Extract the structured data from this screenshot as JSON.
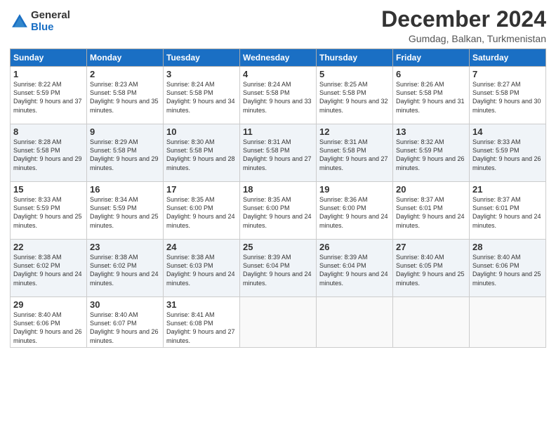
{
  "logo": {
    "general": "General",
    "blue": "Blue"
  },
  "header": {
    "month_title": "December 2024",
    "location": "Gumdag, Balkan, Turkmenistan"
  },
  "days_of_week": [
    "Sunday",
    "Monday",
    "Tuesday",
    "Wednesday",
    "Thursday",
    "Friday",
    "Saturday"
  ],
  "weeks": [
    [
      {
        "day": "1",
        "sunrise": "Sunrise: 8:22 AM",
        "sunset": "Sunset: 5:59 PM",
        "daylight": "Daylight: 9 hours and 37 minutes."
      },
      {
        "day": "2",
        "sunrise": "Sunrise: 8:23 AM",
        "sunset": "Sunset: 5:58 PM",
        "daylight": "Daylight: 9 hours and 35 minutes."
      },
      {
        "day": "3",
        "sunrise": "Sunrise: 8:24 AM",
        "sunset": "Sunset: 5:58 PM",
        "daylight": "Daylight: 9 hours and 34 minutes."
      },
      {
        "day": "4",
        "sunrise": "Sunrise: 8:24 AM",
        "sunset": "Sunset: 5:58 PM",
        "daylight": "Daylight: 9 hours and 33 minutes."
      },
      {
        "day": "5",
        "sunrise": "Sunrise: 8:25 AM",
        "sunset": "Sunset: 5:58 PM",
        "daylight": "Daylight: 9 hours and 32 minutes."
      },
      {
        "day": "6",
        "sunrise": "Sunrise: 8:26 AM",
        "sunset": "Sunset: 5:58 PM",
        "daylight": "Daylight: 9 hours and 31 minutes."
      },
      {
        "day": "7",
        "sunrise": "Sunrise: 8:27 AM",
        "sunset": "Sunset: 5:58 PM",
        "daylight": "Daylight: 9 hours and 30 minutes."
      }
    ],
    [
      {
        "day": "8",
        "sunrise": "Sunrise: 8:28 AM",
        "sunset": "Sunset: 5:58 PM",
        "daylight": "Daylight: 9 hours and 29 minutes."
      },
      {
        "day": "9",
        "sunrise": "Sunrise: 8:29 AM",
        "sunset": "Sunset: 5:58 PM",
        "daylight": "Daylight: 9 hours and 29 minutes."
      },
      {
        "day": "10",
        "sunrise": "Sunrise: 8:30 AM",
        "sunset": "Sunset: 5:58 PM",
        "daylight": "Daylight: 9 hours and 28 minutes."
      },
      {
        "day": "11",
        "sunrise": "Sunrise: 8:31 AM",
        "sunset": "Sunset: 5:58 PM",
        "daylight": "Daylight: 9 hours and 27 minutes."
      },
      {
        "day": "12",
        "sunrise": "Sunrise: 8:31 AM",
        "sunset": "Sunset: 5:58 PM",
        "daylight": "Daylight: 9 hours and 27 minutes."
      },
      {
        "day": "13",
        "sunrise": "Sunrise: 8:32 AM",
        "sunset": "Sunset: 5:59 PM",
        "daylight": "Daylight: 9 hours and 26 minutes."
      },
      {
        "day": "14",
        "sunrise": "Sunrise: 8:33 AM",
        "sunset": "Sunset: 5:59 PM",
        "daylight": "Daylight: 9 hours and 26 minutes."
      }
    ],
    [
      {
        "day": "15",
        "sunrise": "Sunrise: 8:33 AM",
        "sunset": "Sunset: 5:59 PM",
        "daylight": "Daylight: 9 hours and 25 minutes."
      },
      {
        "day": "16",
        "sunrise": "Sunrise: 8:34 AM",
        "sunset": "Sunset: 5:59 PM",
        "daylight": "Daylight: 9 hours and 25 minutes."
      },
      {
        "day": "17",
        "sunrise": "Sunrise: 8:35 AM",
        "sunset": "Sunset: 6:00 PM",
        "daylight": "Daylight: 9 hours and 24 minutes."
      },
      {
        "day": "18",
        "sunrise": "Sunrise: 8:35 AM",
        "sunset": "Sunset: 6:00 PM",
        "daylight": "Daylight: 9 hours and 24 minutes."
      },
      {
        "day": "19",
        "sunrise": "Sunrise: 8:36 AM",
        "sunset": "Sunset: 6:00 PM",
        "daylight": "Daylight: 9 hours and 24 minutes."
      },
      {
        "day": "20",
        "sunrise": "Sunrise: 8:37 AM",
        "sunset": "Sunset: 6:01 PM",
        "daylight": "Daylight: 9 hours and 24 minutes."
      },
      {
        "day": "21",
        "sunrise": "Sunrise: 8:37 AM",
        "sunset": "Sunset: 6:01 PM",
        "daylight": "Daylight: 9 hours and 24 minutes."
      }
    ],
    [
      {
        "day": "22",
        "sunrise": "Sunrise: 8:38 AM",
        "sunset": "Sunset: 6:02 PM",
        "daylight": "Daylight: 9 hours and 24 minutes."
      },
      {
        "day": "23",
        "sunrise": "Sunrise: 8:38 AM",
        "sunset": "Sunset: 6:02 PM",
        "daylight": "Daylight: 9 hours and 24 minutes."
      },
      {
        "day": "24",
        "sunrise": "Sunrise: 8:38 AM",
        "sunset": "Sunset: 6:03 PM",
        "daylight": "Daylight: 9 hours and 24 minutes."
      },
      {
        "day": "25",
        "sunrise": "Sunrise: 8:39 AM",
        "sunset": "Sunset: 6:04 PM",
        "daylight": "Daylight: 9 hours and 24 minutes."
      },
      {
        "day": "26",
        "sunrise": "Sunrise: 8:39 AM",
        "sunset": "Sunset: 6:04 PM",
        "daylight": "Daylight: 9 hours and 24 minutes."
      },
      {
        "day": "27",
        "sunrise": "Sunrise: 8:40 AM",
        "sunset": "Sunset: 6:05 PM",
        "daylight": "Daylight: 9 hours and 25 minutes."
      },
      {
        "day": "28",
        "sunrise": "Sunrise: 8:40 AM",
        "sunset": "Sunset: 6:06 PM",
        "daylight": "Daylight: 9 hours and 25 minutes."
      }
    ],
    [
      {
        "day": "29",
        "sunrise": "Sunrise: 8:40 AM",
        "sunset": "Sunset: 6:06 PM",
        "daylight": "Daylight: 9 hours and 26 minutes."
      },
      {
        "day": "30",
        "sunrise": "Sunrise: 8:40 AM",
        "sunset": "Sunset: 6:07 PM",
        "daylight": "Daylight: 9 hours and 26 minutes."
      },
      {
        "day": "31",
        "sunrise": "Sunrise: 8:41 AM",
        "sunset": "Sunset: 6:08 PM",
        "daylight": "Daylight: 9 hours and 27 minutes."
      },
      null,
      null,
      null,
      null
    ]
  ]
}
